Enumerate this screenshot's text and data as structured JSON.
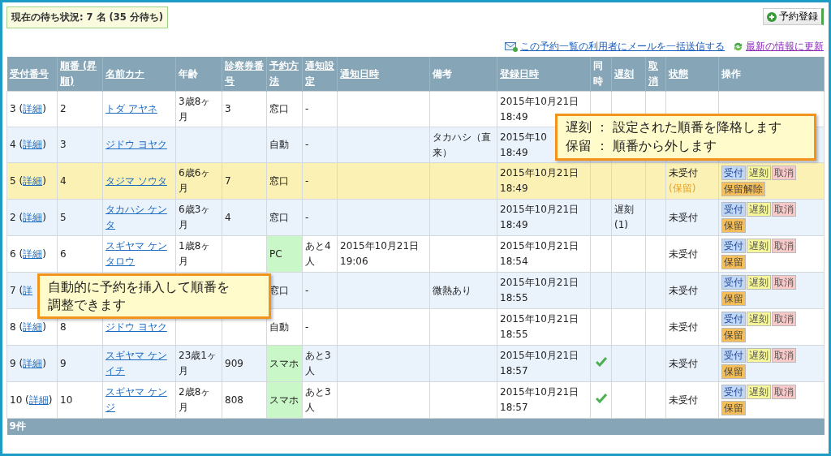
{
  "wait_status": "現在の待ち状況: 7 名 (35 分待ち)",
  "register_button": "予約登録",
  "links": [
    {
      "kind": "mail",
      "label": "この予約一覧の利用者にメールを一括送信する"
    },
    {
      "kind": "refresh",
      "label": "最新の情報に更新"
    }
  ],
  "table": {
    "columns": [
      {
        "label": "受付番号",
        "sortable": true
      },
      {
        "label": "順番 (昇順)",
        "sortable": true
      },
      {
        "label": "名前カナ",
        "sortable": true
      },
      {
        "label": "年齢",
        "sortable": false
      },
      {
        "label": "診察券番号",
        "sortable": true
      },
      {
        "label": "予約方法",
        "sortable": true
      },
      {
        "label": "通知設定",
        "sortable": true
      },
      {
        "label": "通知日時",
        "sortable": true
      },
      {
        "label": "備考",
        "sortable": false
      },
      {
        "label": "登録日時",
        "sortable": true
      },
      {
        "label": "同時",
        "sortable": false
      },
      {
        "label": "遅刻",
        "sortable": true
      },
      {
        "label": "取消",
        "sortable": true
      },
      {
        "label": "状態",
        "sortable": true
      },
      {
        "label": "操作",
        "sortable": false
      }
    ],
    "rows": [
      {
        "prefix": "3 (",
        "link": "詳細",
        "suffix": ")",
        "order": "2",
        "name": "トダ アヤネ",
        "age": "3歳8ヶ月",
        "card": "3",
        "method": "窓口",
        "online": false,
        "notify": "-",
        "notify_time": "",
        "note": "",
        "registered": "2015年10月21日\n18:49",
        "same": false,
        "late": "",
        "status": "",
        "status_note": "",
        "highlighted": false,
        "actions": []
      },
      {
        "prefix": "4 (",
        "link": "詳細",
        "suffix": ")",
        "order": "3",
        "name": "ジドウ ヨヤク",
        "age": "",
        "card": "",
        "method": "自動",
        "online": false,
        "notify": "-",
        "notify_time": "",
        "note": "タカハシ（直来）",
        "registered": "2015年10\n18:49",
        "late": "",
        "status": "",
        "status_note": "",
        "highlighted": false,
        "actions": []
      },
      {
        "prefix": "5 (",
        "link": "詳細",
        "suffix": ")",
        "order": "4",
        "name": "タジマ ソウタ",
        "age": "6歳6ヶ月",
        "card": "7",
        "method": "窓口",
        "online": false,
        "notify": "-",
        "notify_time": "",
        "note": "",
        "registered": "2015年10月21日 18:49",
        "same": false,
        "late": "",
        "status": "未受付",
        "status_note": "(保留)",
        "highlighted": true,
        "actions": [
          {
            "label": "受付",
            "kind": "accept"
          },
          {
            "label": "遅刻",
            "kind": "late"
          },
          {
            "label": "取消",
            "kind": "cancel"
          },
          {
            "label": "保留解除",
            "kind": "hold"
          }
        ]
      },
      {
        "prefix": "2 (",
        "link": "詳細",
        "suffix": ")",
        "order": "5",
        "name": "タカハシ ケンタ",
        "age": "6歳3ヶ月",
        "card": "4",
        "method": "窓口",
        "online": false,
        "notify": "-",
        "notify_time": "",
        "note": "",
        "registered": "2015年10月21日 18:49",
        "same": false,
        "late": "遅刻 (1)",
        "status": "未受付",
        "status_note": "",
        "highlighted": false,
        "actions": [
          {
            "label": "受付",
            "kind": "accept"
          },
          {
            "label": "遅刻",
            "kind": "late"
          },
          {
            "label": "取消",
            "kind": "cancel"
          },
          {
            "label": "保留",
            "kind": "hold"
          }
        ]
      },
      {
        "prefix": "6 (",
        "link": "詳細",
        "suffix": ")",
        "order": "6",
        "name": "スギヤマ ケンタロウ",
        "age": "1歳8ヶ月",
        "card": "",
        "method": "PC",
        "online": true,
        "notify": "あと4人",
        "notify_time": "2015年10月21日 19:06",
        "note": "",
        "registered": "2015年10月21日 18:54",
        "same": false,
        "late": "",
        "status": "未受付",
        "status_note": "",
        "highlighted": false,
        "actions": [
          {
            "label": "受付",
            "kind": "accept"
          },
          {
            "label": "遅刻",
            "kind": "late"
          },
          {
            "label": "取消",
            "kind": "cancel"
          },
          {
            "label": "保留",
            "kind": "hold"
          }
        ]
      },
      {
        "prefix": "7 (",
        "link": "詳",
        "suffix": "",
        "order": "",
        "name": "",
        "age": "",
        "card": "",
        "method": "窓口",
        "online": false,
        "notify": "-",
        "notify_time": "",
        "note": "微熱あり",
        "registered": "2015年10月21日 18:55",
        "same": false,
        "late": "",
        "status": "未受付",
        "status_note": "",
        "highlighted": false,
        "actions": [
          {
            "label": "受付",
            "kind": "accept"
          },
          {
            "label": "遅刻",
            "kind": "late"
          },
          {
            "label": "取消",
            "kind": "cancel"
          },
          {
            "label": "保留",
            "kind": "hold"
          }
        ]
      },
      {
        "prefix": "8 (",
        "link": "詳細",
        "suffix": ")",
        "order": "8",
        "name": "ジドウ ヨヤク",
        "age": "",
        "card": "",
        "method": "自動",
        "online": false,
        "notify": "-",
        "notify_time": "",
        "note": "",
        "registered": "2015年10月21日 18:55",
        "same": false,
        "late": "",
        "status": "未受付",
        "status_note": "",
        "highlighted": false,
        "actions": [
          {
            "label": "受付",
            "kind": "accept"
          },
          {
            "label": "遅刻",
            "kind": "late"
          },
          {
            "label": "取消",
            "kind": "cancel"
          },
          {
            "label": "保留",
            "kind": "hold"
          }
        ]
      },
      {
        "prefix": "9 (",
        "link": "詳細",
        "suffix": ")",
        "order": "9",
        "name": "スギヤマ ケンイチ",
        "age": "23歳1ヶ月",
        "card": "909",
        "method": "スマホ",
        "online": true,
        "notify": "あと3人",
        "notify_time": "",
        "note": "",
        "registered": "2015年10月21日 18:57",
        "same": true,
        "late": "",
        "status": "未受付",
        "status_note": "",
        "highlighted": false,
        "actions": [
          {
            "label": "受付",
            "kind": "accept"
          },
          {
            "label": "遅刻",
            "kind": "late"
          },
          {
            "label": "取消",
            "kind": "cancel"
          },
          {
            "label": "保留",
            "kind": "hold"
          }
        ]
      },
      {
        "prefix": "10 (",
        "link": "詳細",
        "suffix": ")",
        "order": "10",
        "name": "スギヤマ ケンジ",
        "age": "2歳8ヶ月",
        "card": "808",
        "method": "スマホ",
        "online": true,
        "notify": "あと3人",
        "notify_time": "",
        "note": "",
        "registered": "2015年10月21日 18:57",
        "same": true,
        "late": "",
        "status": "未受付",
        "status_note": "",
        "highlighted": false,
        "actions": [
          {
            "label": "受付",
            "kind": "accept"
          },
          {
            "label": "遅刻",
            "kind": "late"
          },
          {
            "label": "取消",
            "kind": "cancel"
          },
          {
            "label": "保留",
            "kind": "hold"
          }
        ]
      }
    ],
    "footer": "9件"
  },
  "callouts": [
    {
      "kind": "right",
      "lines": [
        "遅刻 ： 設定された順番を降格します",
        "保留 ： 順番から外します"
      ]
    },
    {
      "kind": "left",
      "lines": [
        "自動的に予約を挿入して順番を",
        "調整できます"
      ]
    }
  ]
}
